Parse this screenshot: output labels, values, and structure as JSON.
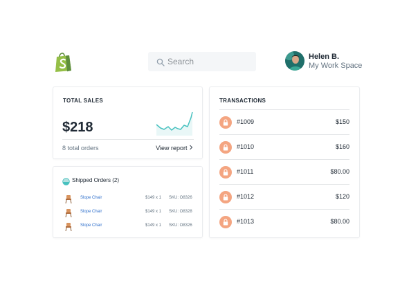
{
  "header": {
    "logo_icon": "shopify-bag-icon",
    "search": {
      "placeholder": "Search",
      "value": ""
    },
    "profile": {
      "name": "Helen B.",
      "workspace": "My Work Space"
    }
  },
  "sales": {
    "title": "TOTAL SALES",
    "amount": "$218",
    "orders": "8 total orders",
    "link": "View report",
    "accent": "#47c1bf"
  },
  "shipped": {
    "title": "Shipped Orders (2)",
    "items": [
      {
        "product": "Slope Chair",
        "price": "$149 x 1",
        "sku": "SKU: O8326"
      },
      {
        "product": "Slope Chair",
        "price": "$149 x 1",
        "sku": "SKU: O8328"
      },
      {
        "product": "Slope Chair",
        "price": "$149 x 1",
        "sku": "SKU: O8326"
      }
    ]
  },
  "transactions": {
    "title": "TRANSACTIONS",
    "lock_color": "#f4a581",
    "rows": [
      {
        "id": "#1009",
        "amount": "$150"
      },
      {
        "id": "#1010",
        "amount": "$160"
      },
      {
        "id": "#1011",
        "amount": "$80.00"
      },
      {
        "id": "#1012",
        "amount": "$120"
      },
      {
        "id": "#1013",
        "amount": "$80.00"
      }
    ]
  }
}
